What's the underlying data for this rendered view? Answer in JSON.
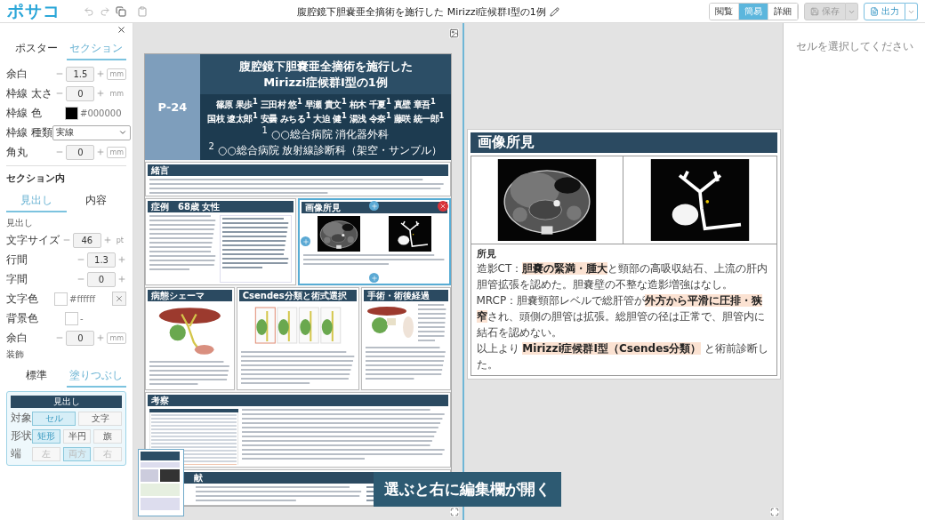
{
  "toolbar": {
    "logo": "ポサコ",
    "document_title": "腹腔鏡下胆嚢亜全摘術を施行した Mirizzi症候群Ⅰ型の1例"
  },
  "view_modes": [
    {
      "label": "閲覧",
      "selected": false
    },
    {
      "label": "簡易",
      "selected": true
    },
    {
      "label": "詳細",
      "selected": false
    }
  ],
  "save_button": {
    "label": "保存",
    "disabled": true
  },
  "export_button": {
    "label": "出力"
  },
  "left_panel": {
    "tabs": [
      {
        "label": "ポスター",
        "selected": false
      },
      {
        "label": "セクション",
        "selected": true
      }
    ],
    "frame_fields": [
      {
        "kind": "stepper",
        "label": "余白",
        "value": "1.5",
        "unit": "mm",
        "unit_boxed": true
      },
      {
        "kind": "stepper",
        "label": "枠線 太さ",
        "value": "0",
        "unit": "mm",
        "unit_boxed": false
      },
      {
        "kind": "color",
        "label": "枠線 色",
        "color": "#000000",
        "value": "#000000"
      },
      {
        "kind": "select",
        "label": "枠線 種類",
        "value": "実線"
      },
      {
        "kind": "stepper",
        "label": "角丸",
        "value": "0",
        "unit": "mm",
        "unit_boxed": true
      }
    ],
    "section_title": "セクション内",
    "section_tabs": [
      {
        "label": "見出し",
        "selected": true
      },
      {
        "label": "内容",
        "selected": false
      }
    ],
    "subheading": "見出し",
    "heading_fields": [
      {
        "kind": "stepper",
        "label": "文字サイズ",
        "value": "46",
        "unit": "pt",
        "unit_boxed": false
      },
      {
        "kind": "stepper",
        "label": "行間",
        "value": "1.3"
      },
      {
        "kind": "stepper",
        "label": "字間",
        "value": "0"
      },
      {
        "kind": "color",
        "label": "文字色",
        "color": "#ffffff",
        "value": "#ffffff",
        "clearable": true
      },
      {
        "kind": "color",
        "label": "背景色",
        "value": "-"
      },
      {
        "kind": "stepper",
        "label": "余白",
        "value": "0",
        "unit": "mm",
        "unit_boxed": true
      }
    ],
    "decoration_label": "装飾",
    "decoration_tabs": [
      {
        "label": "標準",
        "selected": false
      },
      {
        "label": "塗りつぶし",
        "selected": true
      }
    ],
    "preview": {
      "heading": "見出し",
      "rows": [
        {
          "label": "対象",
          "disabled": false,
          "options": [
            {
              "label": "セル",
              "selected": true
            },
            {
              "label": "文字",
              "selected": false
            }
          ]
        },
        {
          "label": "形状",
          "disabled": false,
          "options": [
            {
              "label": "矩形",
              "selected": true
            },
            {
              "label": "半円",
              "selected": false
            },
            {
              "label": "旗",
              "selected": false
            }
          ]
        },
        {
          "label": "端",
          "disabled": true,
          "options": [
            {
              "label": "左",
              "selected": false
            },
            {
              "label": "両方",
              "selected": true
            },
            {
              "label": "右",
              "selected": false
            }
          ]
        }
      ]
    }
  },
  "poster": {
    "number": "P-24",
    "title_lines": [
      "腹腔鏡下胆嚢亜全摘術を施行した",
      "Mirizzi症候群Ⅰ型の1例"
    ],
    "author_lines": [
      "篠原 果歩$^{1}$ 三田村 悠$^{1}$ 早瀬 貴文$^{1}$ 柏木 千夏$^{1}$ 真壁 章吾$^{1}$",
      "国枝 遼太郎$^{1}$ 安曇 みちる$^{1}$ 大迫 健$^{1}$ 湯浅 令奈$^{1}$ 藤咲 統一郎$^{1}$"
    ],
    "affiliations": [
      "$^{1}$ ○○総合病院 消化器外科",
      "$^{2}$ ○○総合病院 放射線診断科（架空・サンプル）"
    ],
    "rows": [
      [
        {
          "heading": "緒言",
          "kind": "text",
          "selected": false
        }
      ],
      [
        {
          "heading": "症例　68歳 女性",
          "kind": "case",
          "selected": false
        },
        {
          "heading": "画像所見",
          "kind": "images",
          "selected": true
        }
      ],
      [
        {
          "heading": "病態シェーマ",
          "kind": "schema",
          "selected": false
        },
        {
          "heading": "Csendes分類と術式選択",
          "kind": "diagram",
          "selected": false
        },
        {
          "heading": "手術・術後経過",
          "kind": "surgery",
          "selected": false
        }
      ],
      [
        {
          "heading": "考察",
          "kind": "discussion",
          "selected": false
        }
      ],
      [
        {
          "heading": "献",
          "kind": "references",
          "selected": false
        }
      ]
    ]
  },
  "editor": {
    "heading": "画像所見",
    "findings_title": "所見",
    "paragraphs": [
      "造影CT：**胆嚢の緊満・腫大**と頸部の高吸収結石、上流の肝内胆管拡張を認めた。胆嚢壁の不整な造影増強はなし。",
      "MRCP：胆嚢頸部レベルで総肝管が**外方から平滑に圧排・狭窄**され、頭側の胆管は拡張。総胆管の径は正常で、胆管内に結石を認めない。",
      "以上より **Mirizzi症候群Ⅰ型（Csendes分類）** と術前診断した。"
    ]
  },
  "properties": {
    "placeholder": "セルを選択してください"
  },
  "caption": "選ぶと右に編集欄が開く"
}
